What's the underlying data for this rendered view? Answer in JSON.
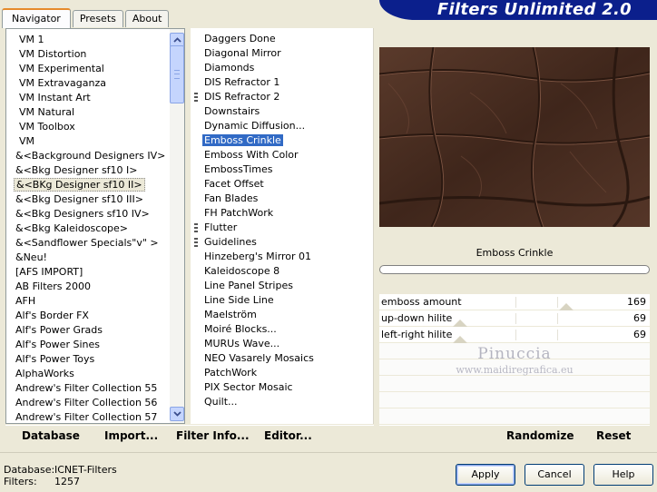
{
  "app": {
    "title": "Filters Unlimited 2.0"
  },
  "tabs": [
    {
      "label": "Navigator"
    },
    {
      "label": "Presets"
    },
    {
      "label": "About"
    }
  ],
  "categories": [
    "VM 1",
    "VM Distortion",
    "VM Experimental",
    "VM Extravaganza",
    "VM Instant Art",
    "VM Natural",
    "VM Toolbox",
    "VM",
    "&<Background Designers IV>",
    "&<Bkg Designer sf10 I>",
    "&<BKg Designer sf10 II>",
    "&<Bkg Designer sf10 III>",
    "&<Bkg Designers sf10 IV>",
    "&<Bkg Kaleidoscope>",
    "&<Sandflower Specials\"v\" >",
    "&Neu!",
    "[AFS IMPORT]",
    "AB Filters 2000",
    "AFH",
    "Alf's Border FX",
    "Alf's Power Grads",
    "Alf's Power Sines",
    "Alf's Power Toys",
    "AlphaWorks",
    "Andrew's Filter Collection 55",
    "Andrew's Filter Collection 56",
    "Andrew's Filter Collection 57"
  ],
  "selected_category": "&<BKg Designer sf10 II>",
  "filters": [
    {
      "label": "Daggers Done",
      "mark": false
    },
    {
      "label": "Diagonal Mirror",
      "mark": false
    },
    {
      "label": "Diamonds",
      "mark": false
    },
    {
      "label": "DIS Refractor 1",
      "mark": false
    },
    {
      "label": "DIS Refractor 2",
      "mark": true
    },
    {
      "label": "Downstairs",
      "mark": false
    },
    {
      "label": "Dynamic Diffusion...",
      "mark": false
    },
    {
      "label": "Emboss Crinkle",
      "mark": false
    },
    {
      "label": "Emboss With Color",
      "mark": false
    },
    {
      "label": "EmbossTimes",
      "mark": false
    },
    {
      "label": "Facet Offset",
      "mark": false
    },
    {
      "label": "Fan Blades",
      "mark": false
    },
    {
      "label": "FH PatchWork",
      "mark": false
    },
    {
      "label": "Flutter",
      "mark": true
    },
    {
      "label": "Guidelines",
      "mark": true
    },
    {
      "label": "Hinzeberg's Mirror 01",
      "mark": false
    },
    {
      "label": "Kaleidoscope 8",
      "mark": false
    },
    {
      "label": "Line Panel Stripes",
      "mark": false
    },
    {
      "label": "Line Side Line",
      "mark": false
    },
    {
      "label": "Maelström",
      "mark": false
    },
    {
      "label": "Moiré Blocks...",
      "mark": false
    },
    {
      "label": "MURUs Wave...",
      "mark": false
    },
    {
      "label": "NEO Vasarely Mosaics",
      "mark": false
    },
    {
      "label": "PatchWork",
      "mark": false
    },
    {
      "label": "PIX Sector Mosaic",
      "mark": false
    },
    {
      "label": "Quilt...",
      "mark": false
    }
  ],
  "selected_filter": "Emboss Crinkle",
  "preview": {
    "filter_name": "Emboss Crinkle",
    "base_color": "#4a2e22"
  },
  "params": [
    {
      "label": "emboss amount",
      "value": "169",
      "level": 0.663
    },
    {
      "label": "up-down hilite",
      "value": "69",
      "level": 0.271
    },
    {
      "label": "left-right hilite",
      "value": "69",
      "level": 0.271
    }
  ],
  "watermark": {
    "name": "Pinuccia",
    "site": "www.maidiregrafica.eu"
  },
  "left_bar": {
    "database": "Database",
    "import": "Import...",
    "filter_info": "Filter Info...",
    "editor": "Editor..."
  },
  "right_bar": {
    "randomize": "Randomize",
    "reset": "Reset"
  },
  "footer": {
    "database_label": "Database:",
    "database_value": "ICNET-Filters",
    "filters_label": "Filters:",
    "filters_value": "1257"
  },
  "buttons": {
    "apply": "Apply",
    "cancel": "Cancel",
    "help": "Help"
  },
  "colors": {
    "banner": "#0b1f8c",
    "selection": "#316ac5",
    "window": "#ece9d8"
  }
}
